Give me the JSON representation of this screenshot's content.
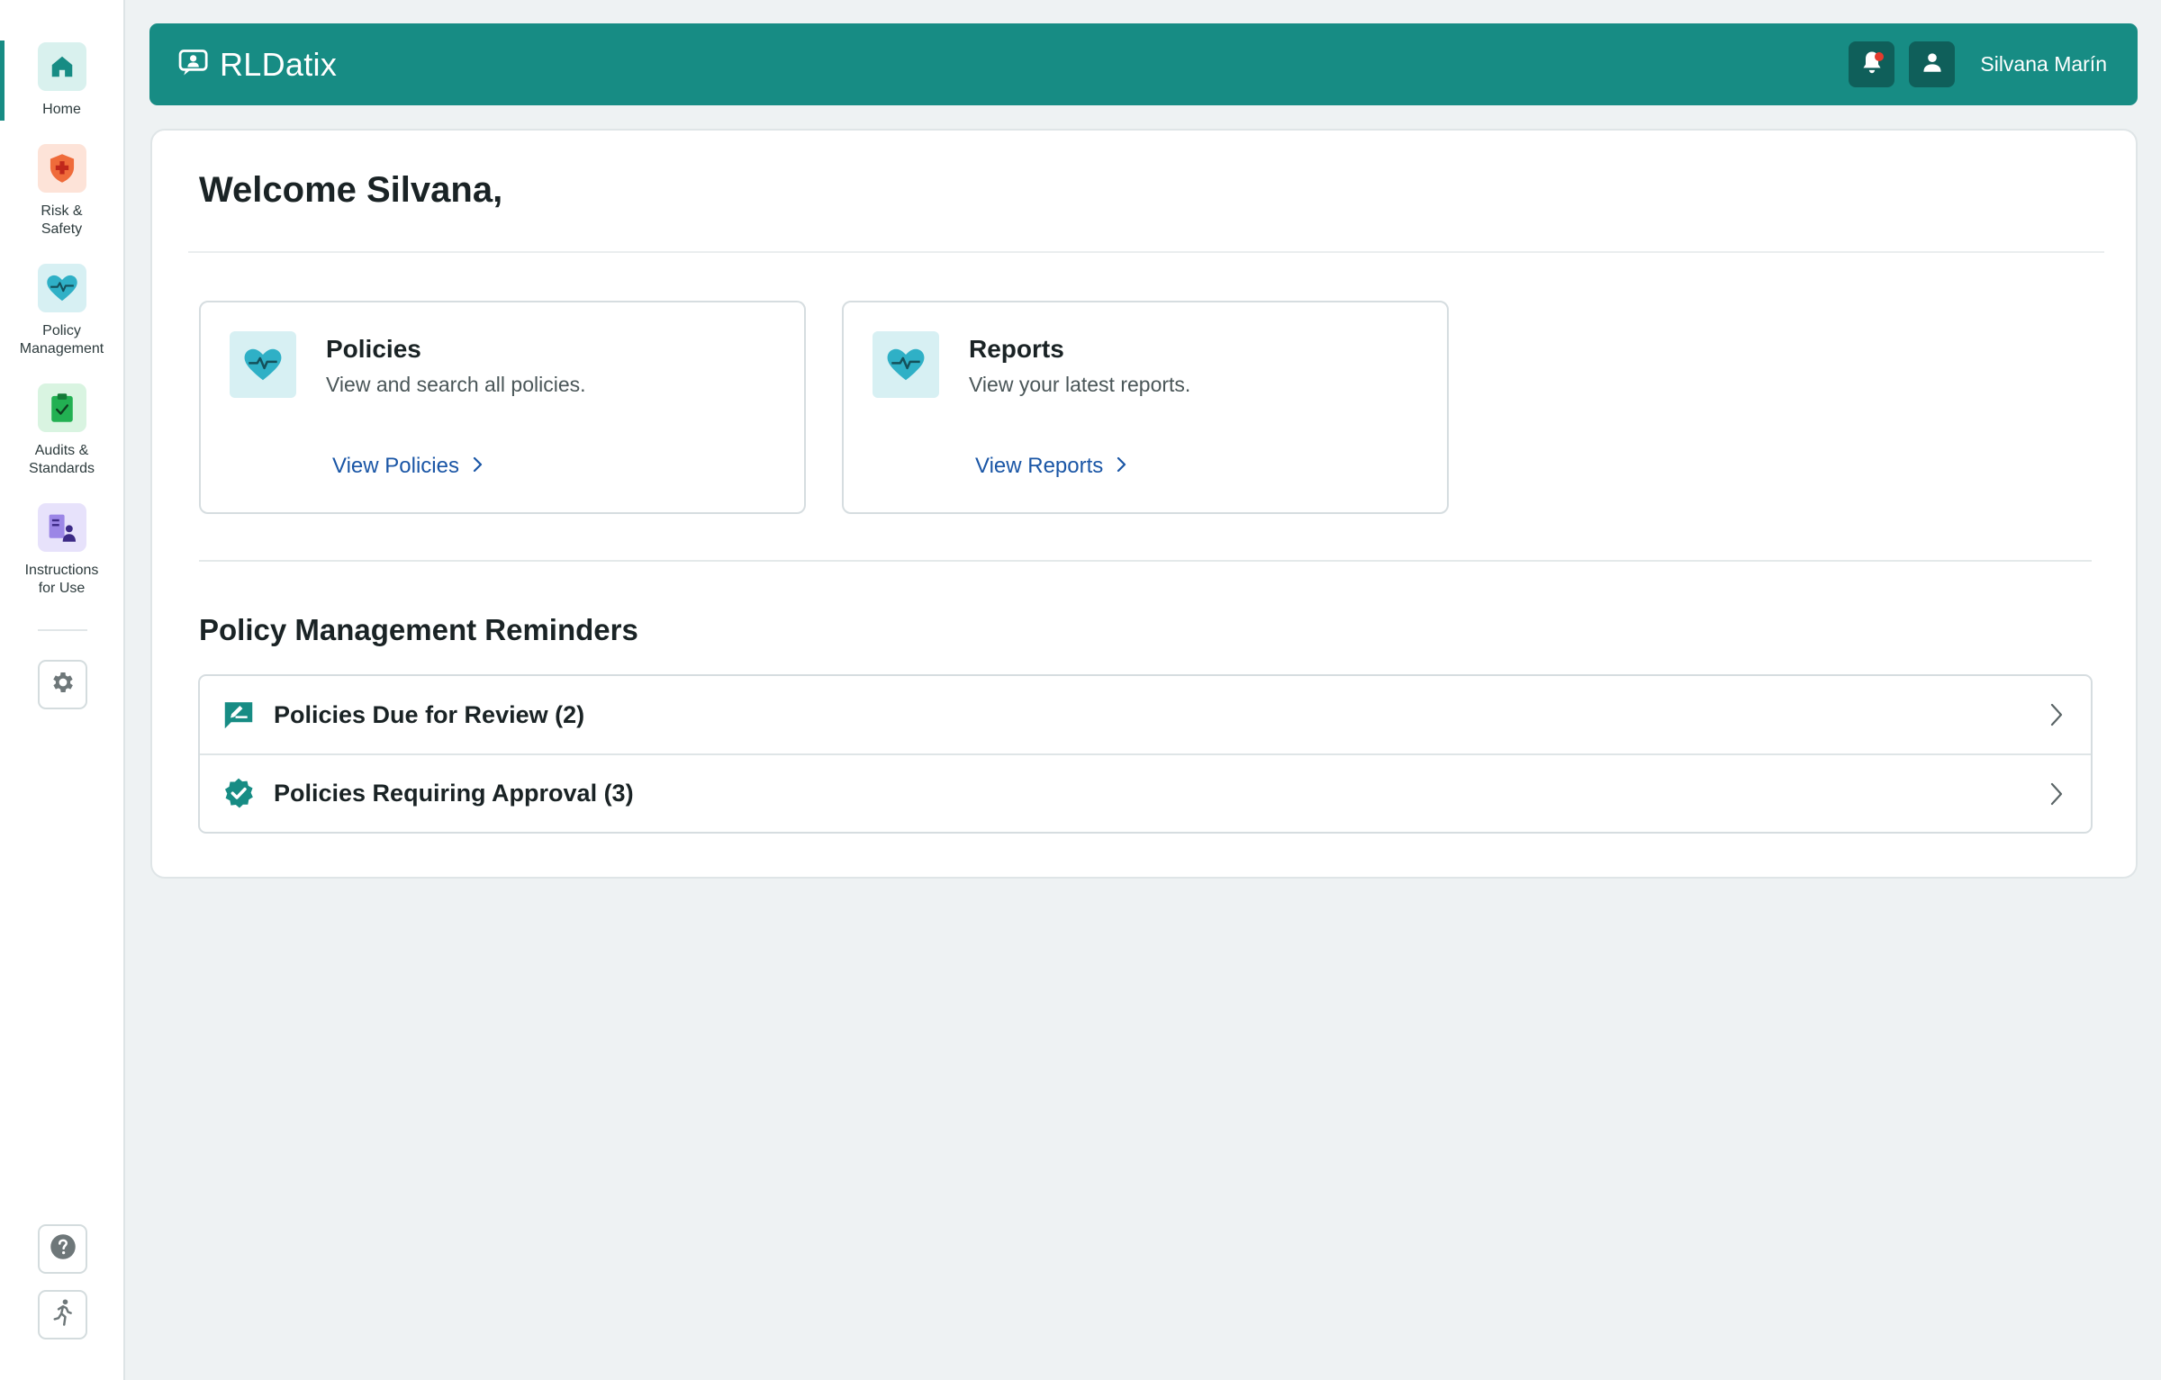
{
  "sidebar": {
    "items": [
      {
        "label": "Home",
        "icon": "home-icon",
        "active": true,
        "color": "#178c84"
      },
      {
        "label": "Risk &\nSafety",
        "icon": "shield-cross-icon",
        "color": "#e8522e"
      },
      {
        "label": "Policy\nManagement",
        "icon": "heart-pulse-icon",
        "color": "#2aa7be"
      },
      {
        "label": "Audits &\nStandards",
        "icon": "clipboard-check-icon",
        "color": "#1fa34a"
      },
      {
        "label": "Instructions\nfor Use",
        "icon": "document-person-icon",
        "color": "#6b4fbf"
      }
    ],
    "bottom": [
      {
        "name": "settings",
        "icon": "gear-icon"
      },
      {
        "name": "help",
        "icon": "question-icon"
      },
      {
        "name": "exit",
        "icon": "running-person-icon"
      }
    ]
  },
  "header": {
    "brand": "RLDatix",
    "user_name": "Silvana Marín",
    "accent": "#178c84",
    "has_notification": true
  },
  "main": {
    "welcome": "Welcome Silvana,",
    "cards": [
      {
        "title": "Policies",
        "description": "View and search all policies.",
        "link": "View Policies",
        "icon": "heart-pulse-icon"
      },
      {
        "title": "Reports",
        "description": "View your latest reports.",
        "link": "View Reports",
        "icon": "heart-pulse-icon"
      }
    ],
    "reminders_title": "Policy Management Reminders",
    "reminders": [
      {
        "label": "Policies Due for Review (2)",
        "icon": "review-edit-icon"
      },
      {
        "label": "Policies Requiring Approval (3)",
        "icon": "verified-badge-icon"
      }
    ]
  }
}
